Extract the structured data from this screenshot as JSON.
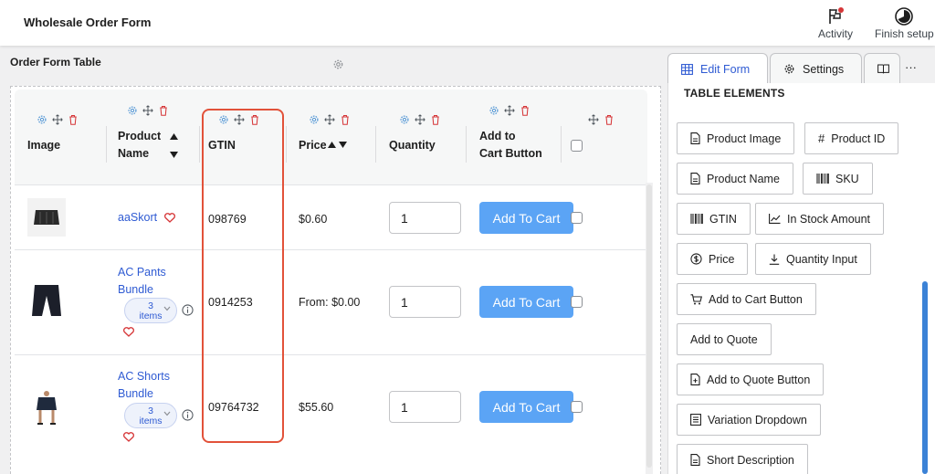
{
  "header": {
    "title": "Wholesale Order Form",
    "activity_label": "Activity",
    "finish_label": "Finish setup"
  },
  "left_panel": {
    "title": "Order Form Table"
  },
  "table": {
    "columns": {
      "image": "Image",
      "product_name_line1": "Product",
      "product_name_line2": "Name",
      "gtin": "GTIN",
      "price": "Price",
      "quantity": "Quantity",
      "add_to_cart_line1": "Add to",
      "add_to_cart_line2": "Cart Button"
    },
    "rows": [
      {
        "name": "aaSkort",
        "gtin": "098769",
        "price": "$0.60",
        "qty": "1",
        "button": "Add To Cart"
      },
      {
        "name_line1": "AC Pants",
        "name_line2": "Bundle",
        "badge_line1": "3",
        "badge_line2": "items",
        "gtin": "0914253",
        "price": "From: $0.00",
        "qty": "1",
        "button": "Add To Cart"
      },
      {
        "name_line1": "AC Shorts",
        "name_line2": "Bundle",
        "badge_line1": "3",
        "badge_line2": "items",
        "gtin": "09764732",
        "price": "$55.60",
        "qty": "1",
        "button": "Add To Cart"
      }
    ]
  },
  "right_panel": {
    "tabs": {
      "edit_form": "Edit Form",
      "settings": "Settings",
      "more": "···"
    },
    "section_title": "TABLE ELEMENTS",
    "elements": {
      "product_image": "Product Image",
      "product_id": "Product ID",
      "product_name": "Product Name",
      "sku": "SKU",
      "gtin": "GTIN",
      "in_stock_amount": "In Stock Amount",
      "price": "Price",
      "quantity_input": "Quantity Input",
      "add_to_cart_button": "Add to Cart Button",
      "add_to_quote": "Add to Quote",
      "add_to_quote_button": "Add to Quote Button",
      "variation_dropdown": "Variation Dropdown",
      "short_description": "Short Description"
    }
  },
  "colors": {
    "accent": "#2f5bd3",
    "cart_button": "#5ba4f5",
    "highlight": "#e2523a",
    "delete_icon": "#d63638",
    "gear_icon": "#4f94d4"
  }
}
